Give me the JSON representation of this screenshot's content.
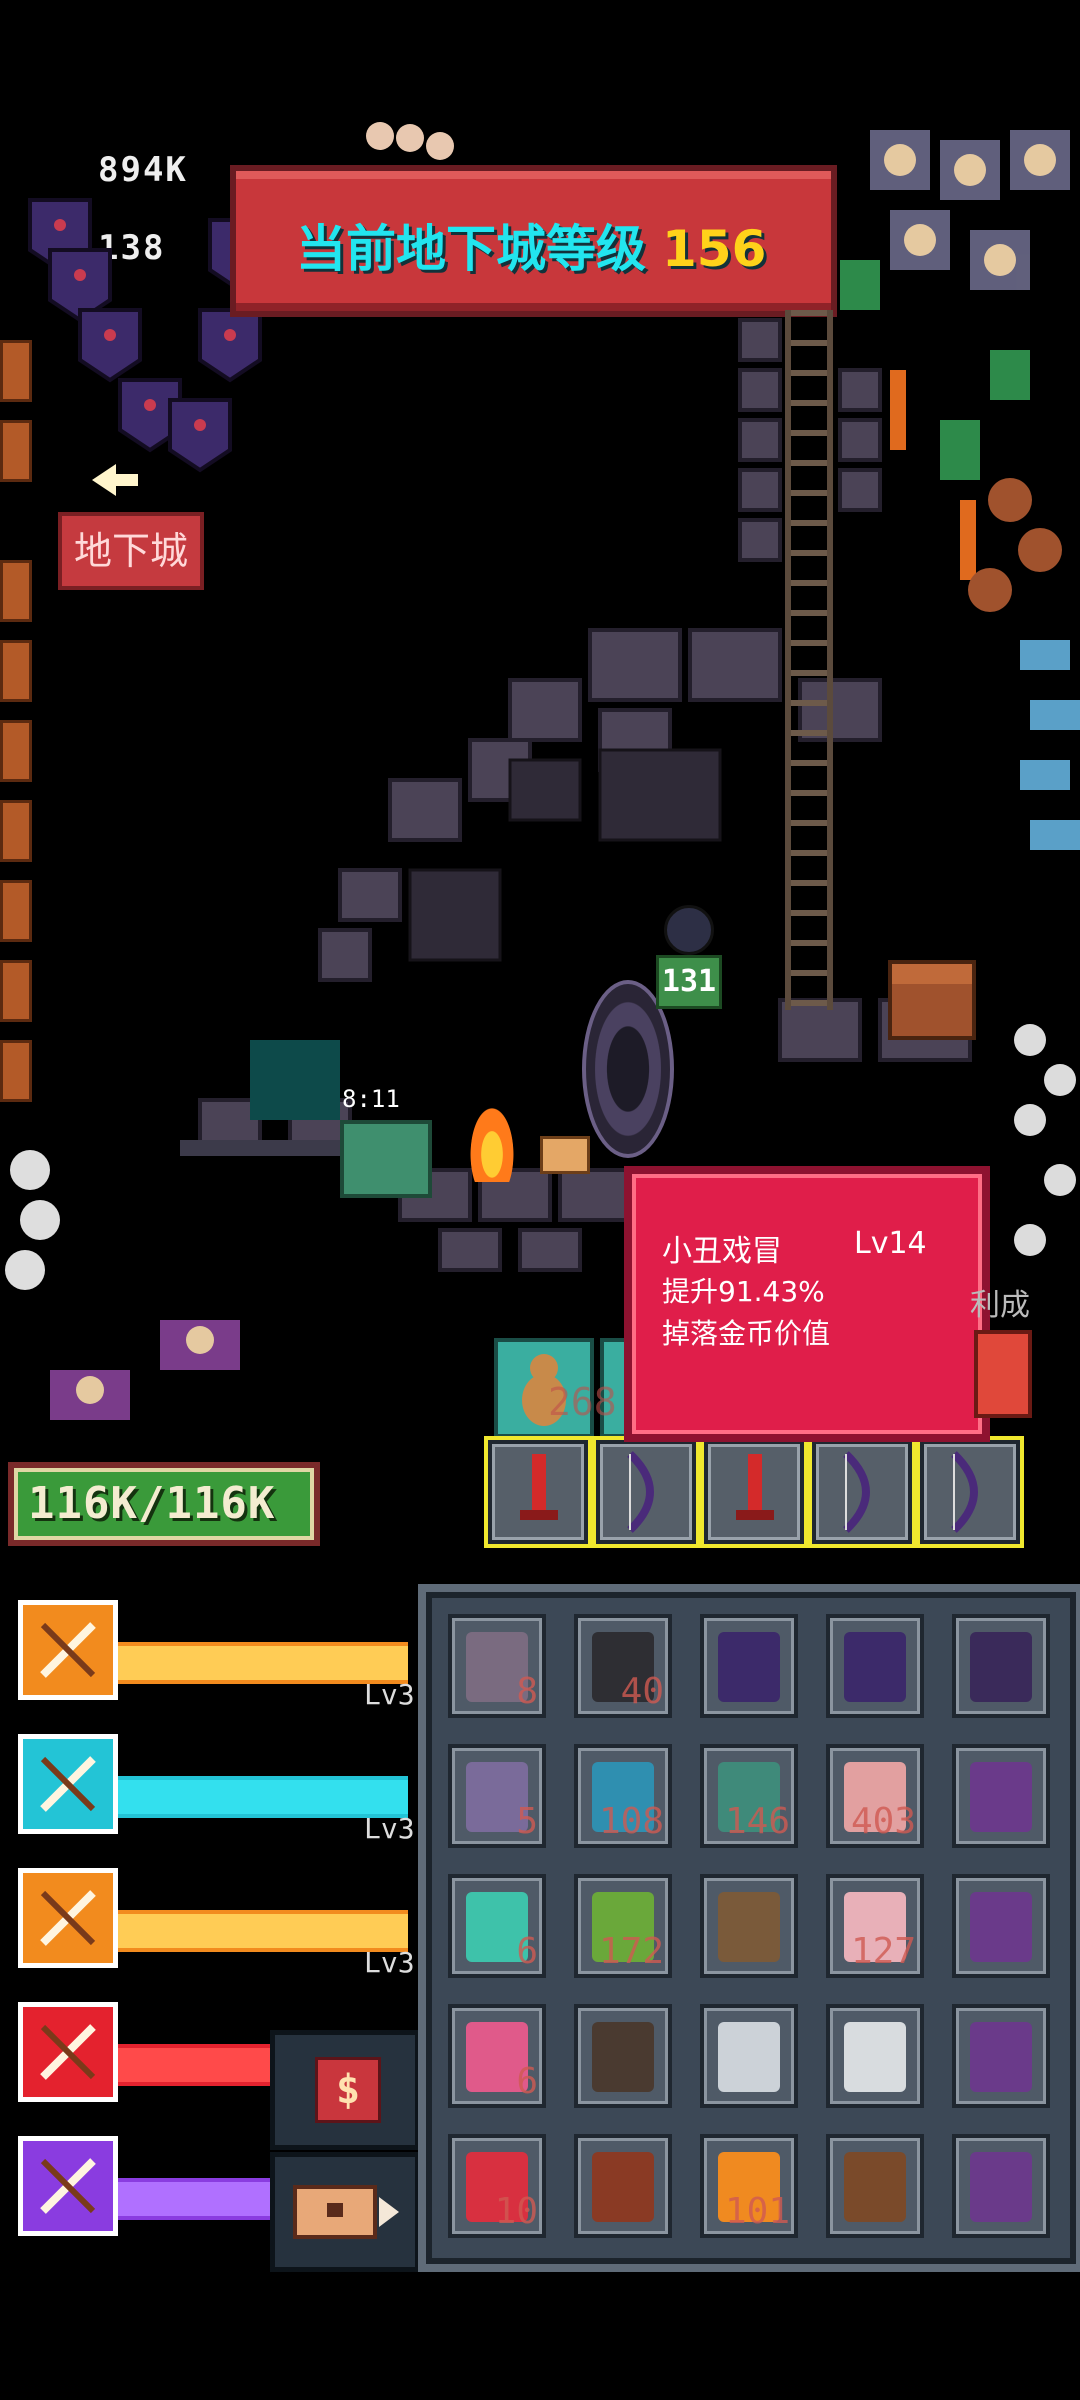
{
  "hud": {
    "gold": "894K",
    "gems": "138",
    "banner_prefix": "当前地下城等级",
    "banner_level": "156",
    "dungeon_button": "地下城"
  },
  "scene": {
    "chest_timer": "8:11",
    "hero_level": "131",
    "partial_label": "利成"
  },
  "tooltip": {
    "name": "小丑戏冒",
    "level": "Lv14",
    "line1": "提升91.43%",
    "line2": "掉落金币价值"
  },
  "player": {
    "hp": "116K/116K"
  },
  "skills": [
    {
      "name": "sword-skill",
      "lv": "Lv3",
      "color": "#f28b1e",
      "bar": "#ffcc55"
    },
    {
      "name": "staff-skill",
      "lv": "Lv3",
      "color": "#23c4d6",
      "bar": "#33e0ee"
    },
    {
      "name": "dagger-skill",
      "lv": "Lv3",
      "color": "#f28b1e",
      "bar": "#ffcc55"
    },
    {
      "name": "fire-skill",
      "lv": "",
      "color": "#e4222e",
      "bar": "#ff4a4a"
    },
    {
      "name": "bow-skill",
      "lv": "",
      "color": "#8a3ce0",
      "bar": "#b070ff"
    }
  ],
  "side_buttons": {
    "shop_symbol": "$"
  },
  "equipment_faint_qty": "268",
  "inventory": [
    {
      "item": "sword-card",
      "qty": "8",
      "color": "#7a6b80"
    },
    {
      "item": "stone",
      "qty": "40",
      "color": "#2e2e33"
    },
    {
      "item": "shield",
      "qty": "",
      "color": "#3c2a6a"
    },
    {
      "item": "shield",
      "qty": "",
      "color": "#3c2a6a"
    },
    {
      "item": "bow",
      "qty": "",
      "color": "#3a2a5a"
    },
    {
      "item": "bow-card",
      "qty": "5",
      "color": "#7a6b9a"
    },
    {
      "item": "blue-potion",
      "qty": "108",
      "color": "#2f8fb0"
    },
    {
      "item": "green-flask",
      "qty": "146",
      "color": "#3f8a7a"
    },
    {
      "item": "red-potion",
      "qty": "403",
      "color": "#e2a0a0"
    },
    {
      "item": "hammer",
      "qty": "",
      "color": "#6a3a8a"
    },
    {
      "item": "leaf-card",
      "qty": "6",
      "color": "#3ec2aa"
    },
    {
      "item": "green-jar",
      "qty": "172",
      "color": "#6aa83a"
    },
    {
      "item": "staff",
      "qty": "",
      "color": "#7a5a3a"
    },
    {
      "item": "pink-potion",
      "qty": "127",
      "color": "#e8b0b8"
    },
    {
      "item": "hammer",
      "qty": "",
      "color": "#6a3a8a"
    },
    {
      "item": "heart-card",
      "qty": "6",
      "color": "#e05a8a"
    },
    {
      "item": "ring-brown",
      "qty": "",
      "color": "#4a3a30"
    },
    {
      "item": "ring-silver",
      "qty": "",
      "color": "#ccd2d8"
    },
    {
      "item": "bracelet",
      "qty": "",
      "color": "#d8dcdf"
    },
    {
      "item": "hammer",
      "qty": "",
      "color": "#6a3a8a"
    },
    {
      "item": "axe-card",
      "qty": "10",
      "color": "#d83040"
    },
    {
      "item": "green-book",
      "qty": "",
      "color": "#8a3a24"
    },
    {
      "item": "orange-orb",
      "qty": "101",
      "color": "#f08a20"
    },
    {
      "item": "eye-book",
      "qty": "",
      "color": "#7a4a2a"
    },
    {
      "item": "hammer",
      "qty": "",
      "color": "#6a3a8a"
    }
  ]
}
